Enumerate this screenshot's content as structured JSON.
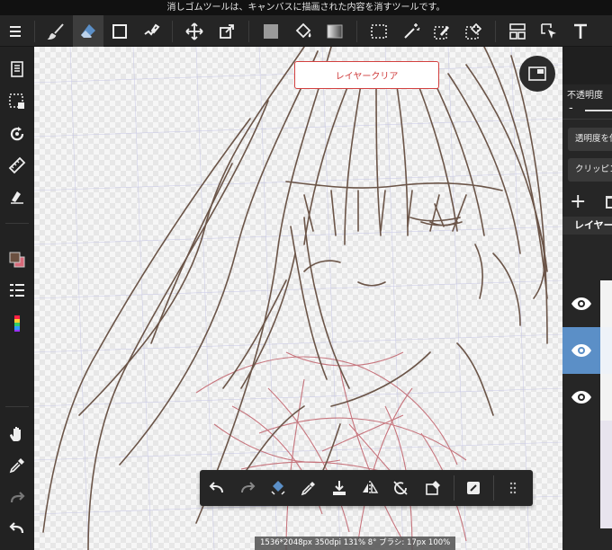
{
  "hint": "消しゴムツールは、キャンバスに描画された内容を消すツールです。",
  "canvas": {
    "clear_layer_label": "レイヤークリア",
    "status_text": "1536*2048px 350dpi 131% 8° ブラシ: 17px 100%"
  },
  "right_panel": {
    "opacity_label": "不透明度",
    "opacity_minus": "-",
    "protect_alpha_label": "透明度を保護",
    "clipping_label": "クリッピング",
    "add_symbol": "+",
    "layer_tab_label": "レイヤー",
    "layers": [
      {
        "visible": true,
        "selected": false
      },
      {
        "visible": true,
        "selected": true
      },
      {
        "visible": true,
        "selected": false
      }
    ]
  },
  "colors": {
    "accent": "#5b8fc7",
    "clear_button_border": "#d3403f",
    "line_art": "#6b5548",
    "rough_sketch": "#c0606a",
    "main_color": "#6b5040",
    "sub_color": "#d86a7a"
  },
  "icons": {
    "topbar": [
      "menu-icon",
      "brush-icon",
      "eraser-icon",
      "shape-icon",
      "fill-brush-icon",
      "move-icon",
      "transform-icon",
      "fill-color-icon",
      "bucket-icon",
      "gradient-icon",
      "select-icon",
      "magic-wand-icon",
      "select-pen-icon",
      "select-eraser-icon",
      "layout-icon",
      "select-pointer-icon",
      "text-icon"
    ],
    "leftbar": [
      "pages-icon",
      "select-layer-icon",
      "rotate-icon",
      "ruler-icon",
      "material-icon",
      "color-swatch-icon",
      "layer-list-icon",
      "color-palette-icon",
      "hand-icon",
      "eyedropper-icon",
      "redo-icon",
      "undo-icon"
    ],
    "floating_toolbar": [
      "undo-icon",
      "redo-icon",
      "transform-eraser-icon",
      "eyedropper-icon",
      "save-icon",
      "flip-icon",
      "rotate-reset-icon",
      "clear-icon",
      "edit-icon",
      "grip-icon"
    ]
  }
}
